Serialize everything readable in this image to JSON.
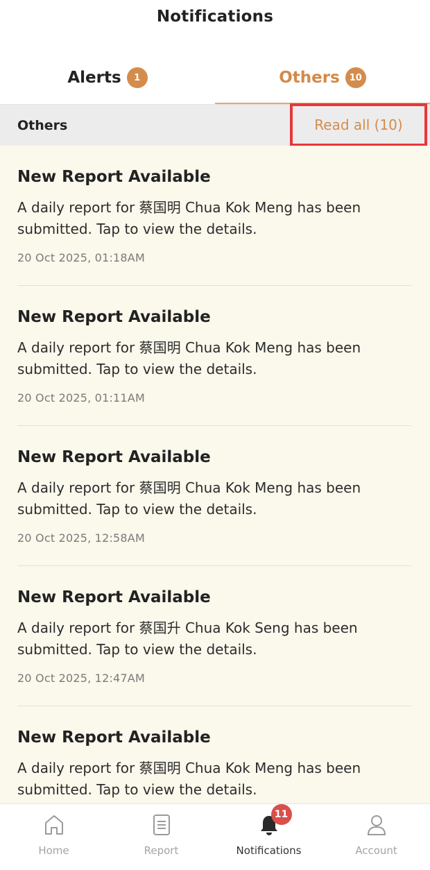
{
  "header": {
    "title": "Notifications"
  },
  "tabs": {
    "alerts": {
      "label": "Alerts",
      "count": "1"
    },
    "others": {
      "label": "Others",
      "count": "10"
    }
  },
  "section": {
    "title": "Others",
    "read_all_label": "Read all (10)"
  },
  "notifications": [
    {
      "title": "New Report Available",
      "body": "A daily report for 蔡国明 Chua Kok Meng has been submitted. Tap to view the details.",
      "time": "20 Oct 2025, 01:18AM"
    },
    {
      "title": "New Report Available",
      "body": "A daily report for 蔡国明 Chua Kok Meng has been submitted. Tap to view the details.",
      "time": "20 Oct 2025, 01:11AM"
    },
    {
      "title": "New Report Available",
      "body": "A daily report for 蔡国明 Chua Kok Meng has been submitted. Tap to view the details.",
      "time": "20 Oct 2025, 12:58AM"
    },
    {
      "title": "New Report Available",
      "body": "A daily report for 蔡国升 Chua Kok Seng has been submitted. Tap to view the details.",
      "time": "20 Oct 2025, 12:47AM"
    },
    {
      "title": "New Report Available",
      "body": "A daily report for 蔡国明 Chua Kok Meng has been submitted. Tap to view the details.",
      "time": ""
    }
  ],
  "bottom_nav": {
    "items": [
      {
        "label": "Home",
        "icon": "home-icon"
      },
      {
        "label": "Report",
        "icon": "report-icon"
      },
      {
        "label": "Notifications",
        "icon": "bell-icon",
        "badge": "11"
      },
      {
        "label": "Account",
        "icon": "account-icon"
      }
    ]
  },
  "colors": {
    "accent": "#d48c4d",
    "highlight_border": "#e6373c",
    "list_background": "#fbf8ec",
    "nav_badge": "#d94f4a"
  }
}
